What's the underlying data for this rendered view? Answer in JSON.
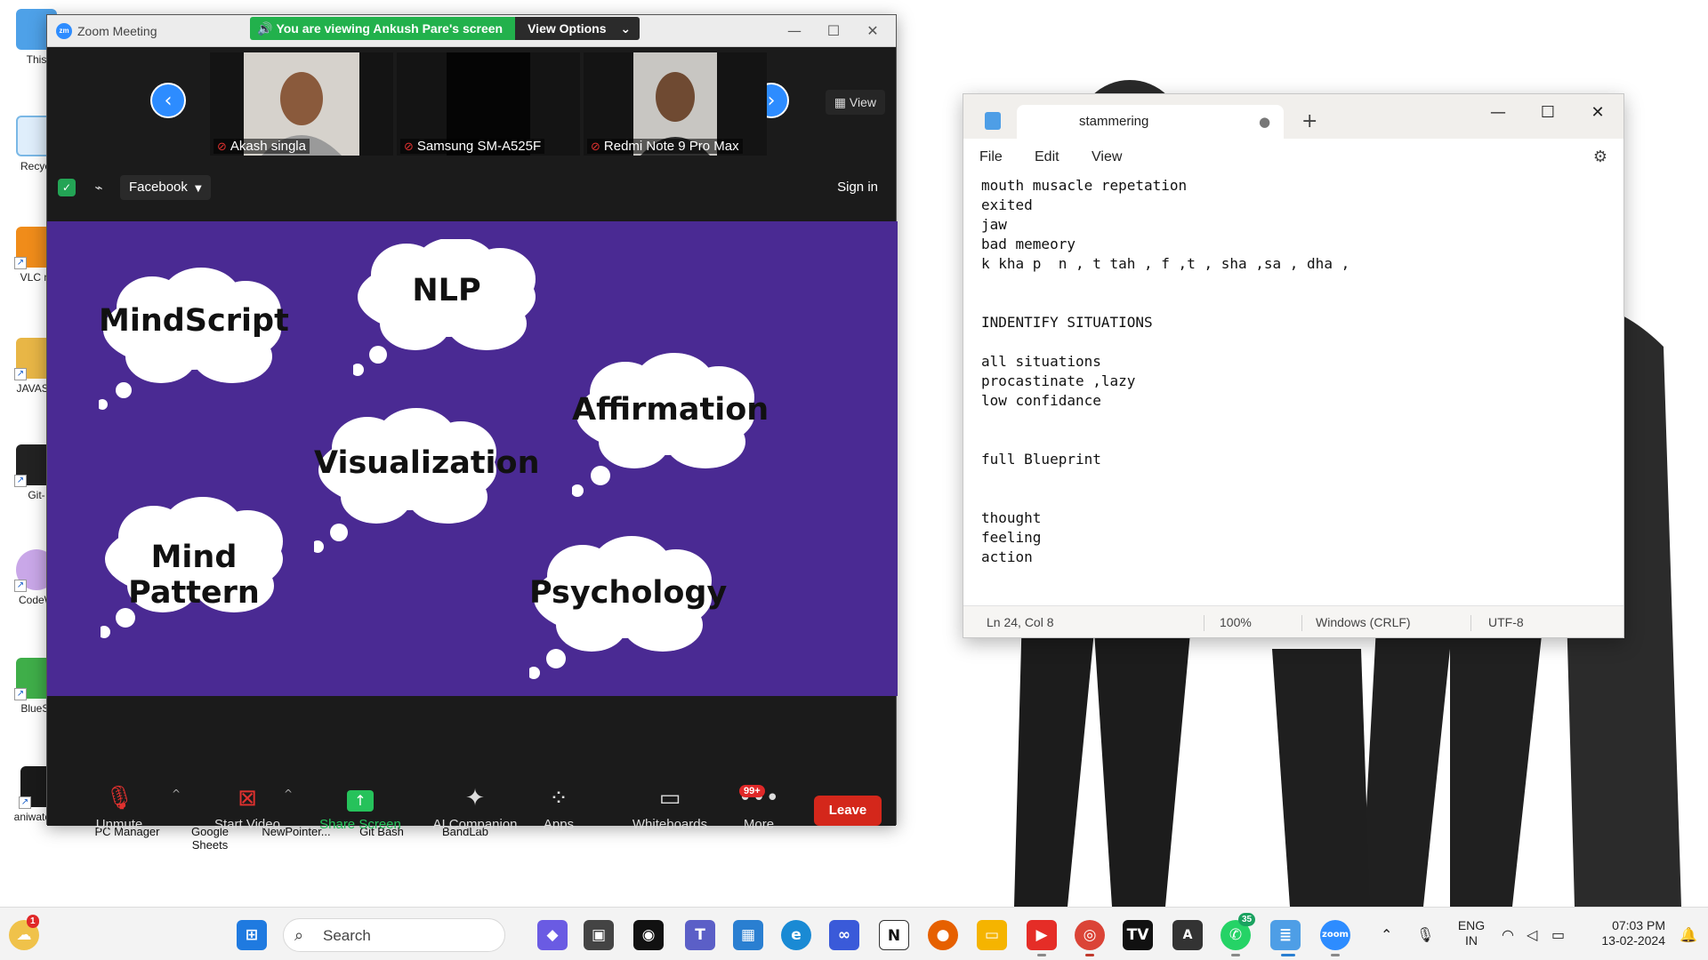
{
  "desktop": {
    "icons": [
      {
        "label": "This",
        "color": "#4ea1e8"
      },
      {
        "label": "Recycl",
        "color": "#7ab8e6"
      },
      {
        "label": "VLC m",
        "color": "#f08c1a"
      },
      {
        "label": "JAVASC",
        "color": "#e8b646"
      },
      {
        "label": "Git-",
        "color": "#222222"
      },
      {
        "label": "CodeW",
        "color": "#c9a7e8"
      },
      {
        "label": "BlueSt",
        "color": "#3fae49"
      },
      {
        "label": "aniwatch.to",
        "color": "#1a1a1a"
      }
    ],
    "bottom_labels": [
      "PC Manager",
      "Google Sheets",
      "NewPointer...",
      "Git Bash",
      "BandLab"
    ]
  },
  "zoom": {
    "title": "Zoom Meeting",
    "logo_text": "zm",
    "banner_text": "You are viewing Ankush Pare's screen",
    "view_options_label": "View Options",
    "view_label": "View",
    "participants": [
      {
        "name": "Akash singla",
        "video": "face1"
      },
      {
        "name": "Samsung SM-A525F",
        "video": "dark"
      },
      {
        "name": "Redmi Note 9 Pro Max",
        "video": "face2"
      }
    ],
    "stream_target": "Facebook",
    "signin_label": "Sign in",
    "slide_clouds": [
      "MindScript",
      "NLP",
      "Affirmation",
      "Visualization",
      "Mind Pattern",
      "Psychology"
    ],
    "slide_bg": "#4a2a93",
    "toolbar": {
      "unmute": "Unmute",
      "start_video": "Start Video",
      "share_screen": "Share Screen",
      "ai_companion": "AI Companion",
      "apps": "Apps",
      "whiteboards": "Whiteboards",
      "more": "More",
      "more_badge": "99+",
      "leave": "Leave"
    }
  },
  "notepad": {
    "tab_title": "stammering",
    "menu": [
      "File",
      "Edit",
      "View"
    ],
    "content": "mouth musacle repetation\nexited\njaw\nbad memeory\nk kha p  n , t tah , f ,t , sha ,sa , dha ,\n\n\nINDENTIFY SITUATIONS\n\nall situations\nprocastinate ,lazy\nlow confidance\n\n\nfull Blueprint\n\n\nthought\nfeeling\naction",
    "status": {
      "position": "Ln 24, Col 8",
      "zoom": "100%",
      "line_ending": "Windows (CRLF)",
      "encoding": "UTF-8"
    }
  },
  "taskbar": {
    "search_placeholder": "Search",
    "weather_badge": "1",
    "whatsapp_badge": "35",
    "language": {
      "line1": "ENG",
      "line2": "IN"
    },
    "time": "07:03 PM",
    "date": "13-02-2024"
  }
}
